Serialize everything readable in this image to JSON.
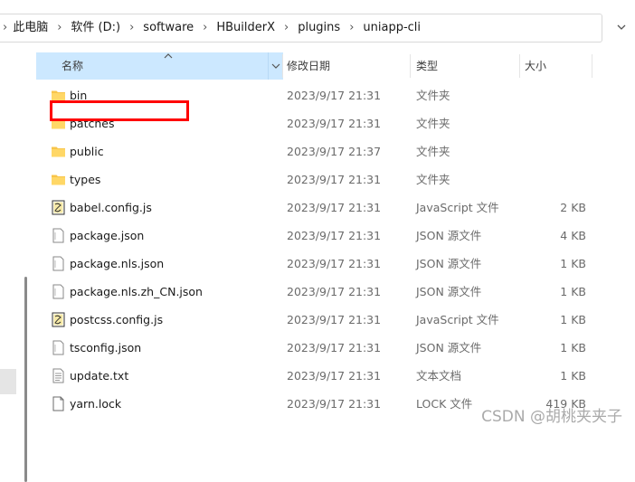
{
  "breadcrumbs": [
    "此电脑",
    "软件 (D:)",
    "software",
    "HBuilderX",
    "plugins",
    "uniapp-cli"
  ],
  "columns": {
    "name": "名称",
    "date": "修改日期",
    "type": "类型",
    "size": "大小"
  },
  "files": [
    {
      "name": "bin",
      "date": "2023/9/17 21:31",
      "type": "文件夹",
      "size": "",
      "icon": "folder-icon"
    },
    {
      "name": "patches",
      "date": "2023/9/17 21:31",
      "type": "文件夹",
      "size": "",
      "icon": "folder-icon"
    },
    {
      "name": "public",
      "date": "2023/9/17 21:37",
      "type": "文件夹",
      "size": "",
      "icon": "folder-icon"
    },
    {
      "name": "types",
      "date": "2023/9/17 21:31",
      "type": "文件夹",
      "size": "",
      "icon": "folder-icon"
    },
    {
      "name": "babel.config.js",
      "date": "2023/9/17 21:31",
      "type": "JavaScript 文件",
      "size": "2 KB",
      "icon": "script-file-icon"
    },
    {
      "name": "package.json",
      "date": "2023/9/17 21:31",
      "type": "JSON 源文件",
      "size": "4 KB",
      "icon": "file-icon"
    },
    {
      "name": "package.nls.json",
      "date": "2023/9/17 21:31",
      "type": "JSON 源文件",
      "size": "1 KB",
      "icon": "file-icon"
    },
    {
      "name": "package.nls.zh_CN.json",
      "date": "2023/9/17 21:31",
      "type": "JSON 源文件",
      "size": "1 KB",
      "icon": "file-icon"
    },
    {
      "name": "postcss.config.js",
      "date": "2023/9/17 21:31",
      "type": "JavaScript 文件",
      "size": "1 KB",
      "icon": "script-file-icon"
    },
    {
      "name": "tsconfig.json",
      "date": "2023/9/17 21:31",
      "type": "JSON 源文件",
      "size": "1 KB",
      "icon": "file-icon"
    },
    {
      "name": "update.txt",
      "date": "2023/9/17 21:31",
      "type": "文本文档",
      "size": "1 KB",
      "icon": "text-file-icon"
    },
    {
      "name": "yarn.lock",
      "date": "2023/9/17 21:31",
      "type": "LOCK 文件",
      "size": "419 KB",
      "icon": "blank-file-icon"
    }
  ],
  "watermark": "CSDN @胡桃夹夹子",
  "colors": {
    "header_highlight": "#cce8ff",
    "annotation_box": "#ff0000",
    "folder": "#f8c54a"
  }
}
